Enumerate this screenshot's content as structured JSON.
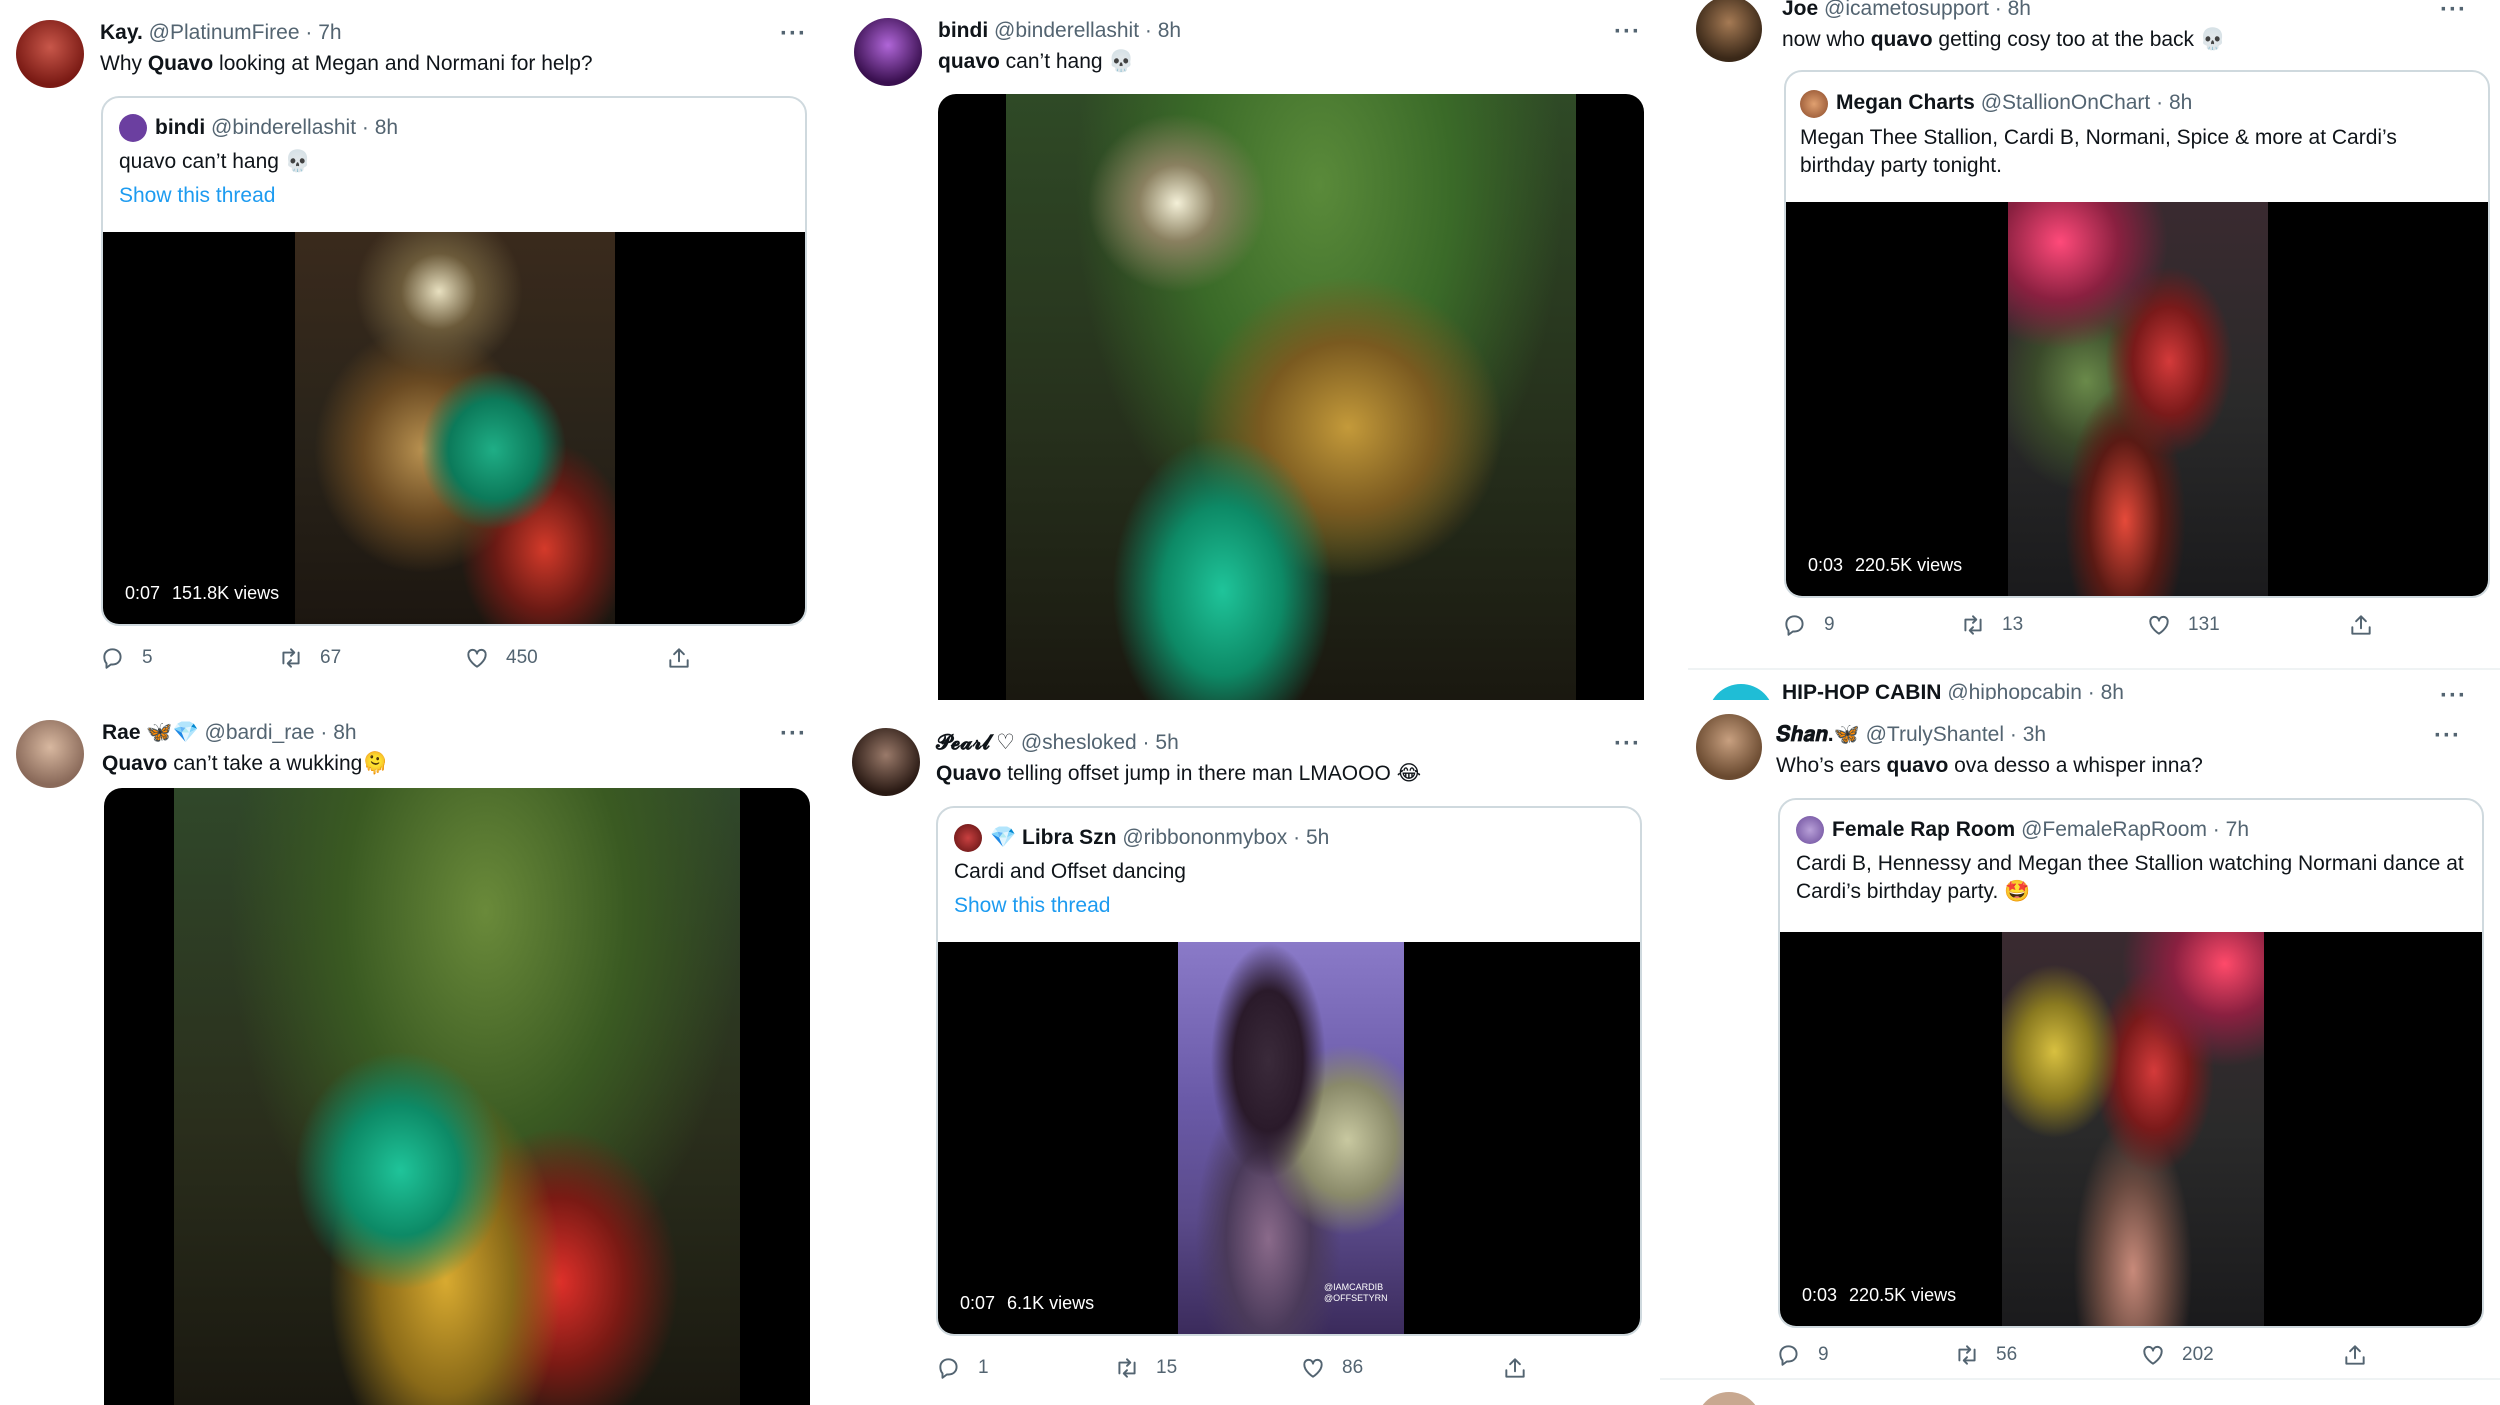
{
  "tweets": [
    {
      "name": "Kay.",
      "handle": "@PlatinumFiree",
      "dot": "·",
      "time": "7h",
      "text_pre": "Why ",
      "text_bold": "Quavo",
      "text_post": " looking at Megan and Normani for help?",
      "quote": {
        "name": "bindi",
        "handle": "@binderellashit",
        "dot": "·",
        "time": "8h",
        "text": "quavo can’t hang 💀",
        "thread": "Show this thread"
      },
      "video": {
        "duration": "0:07",
        "views": "151.8K views"
      },
      "stats": {
        "replies": "5",
        "retweets": "67",
        "likes": "450"
      }
    },
    {
      "name": "bindi",
      "handle": "@binderellashit",
      "dot": "·",
      "time": "8h",
      "text_bold": "quavo",
      "text_post": " can’t hang 💀"
    },
    {
      "name": "Joe",
      "handle": "@icametosupport",
      "dot": "·",
      "time": "8h",
      "text_pre": "now who ",
      "text_bold": "quavo",
      "text_post": " getting cosy too at the back 💀",
      "quote": {
        "name": "Megan Charts",
        "handle": "@StallionOnChart",
        "dot": "·",
        "time": "8h",
        "text": "Megan Thee Stallion, Cardi B, Normani, Spice & more at Cardi’s birthday party tonight."
      },
      "video": {
        "duration": "0:03",
        "views": "220.5K views"
      },
      "stats": {
        "replies": "9",
        "retweets": "13",
        "likes": "131"
      }
    },
    {
      "name": "Rae 🦋💎",
      "handle": "@bardi_rae",
      "dot": "·",
      "time": "8h",
      "text_bold": "Quavo",
      "text_post": " can’t take a wukking🫠"
    },
    {
      "name": "𝓟𝓮𝓪𝓻𝓵 ♡",
      "handle": "@shesloked",
      "dot": "·",
      "time": "5h",
      "text_bold": "Quavo",
      "text_post": " telling offset jump in there man LMAOOO 😂",
      "quote": {
        "name": "Libra Szn",
        "prefix": "💎",
        "handle": "@ribbononmybox",
        "dot": "·",
        "time": "5h",
        "text": "Cardi and Offset dancing",
        "thread": "Show this thread"
      },
      "video": {
        "duration": "0:07",
        "views": "6.1K views",
        "watermark": "@IAMCARDIB @OFFSETYRN"
      },
      "stats": {
        "replies": "1",
        "retweets": "15",
        "likes": "86"
      }
    },
    {
      "name": "𝑺𝒉𝒂𝒏.🦋",
      "handle": "@TrulyShantel",
      "dot": "·",
      "time": "3h",
      "text_pre": "Who’s ears ",
      "text_bold": "quavo",
      "text_post": " ova desso a whisper inna?",
      "quote": {
        "name": "Female Rap Room",
        "handle": "@FemaleRapRoom",
        "dot": "·",
        "time": "7h",
        "text": "Cardi B, Hennessy and Megan thee Stallion watching Normani dance at Cardi’s birthday party. 🤩"
      },
      "video": {
        "duration": "0:03",
        "views": "220.5K views"
      },
      "stats": {
        "replies": "9",
        "retweets": "56",
        "likes": "202"
      }
    }
  ],
  "peek": {
    "name": "HIP-HOP CABIN",
    "handle": "@hiphopcabin",
    "dot": "·",
    "time": "8h"
  },
  "more_label": "···",
  "colors": {
    "link": "#1d9bf0",
    "muted": "#536471",
    "border": "#cfd9de"
  }
}
